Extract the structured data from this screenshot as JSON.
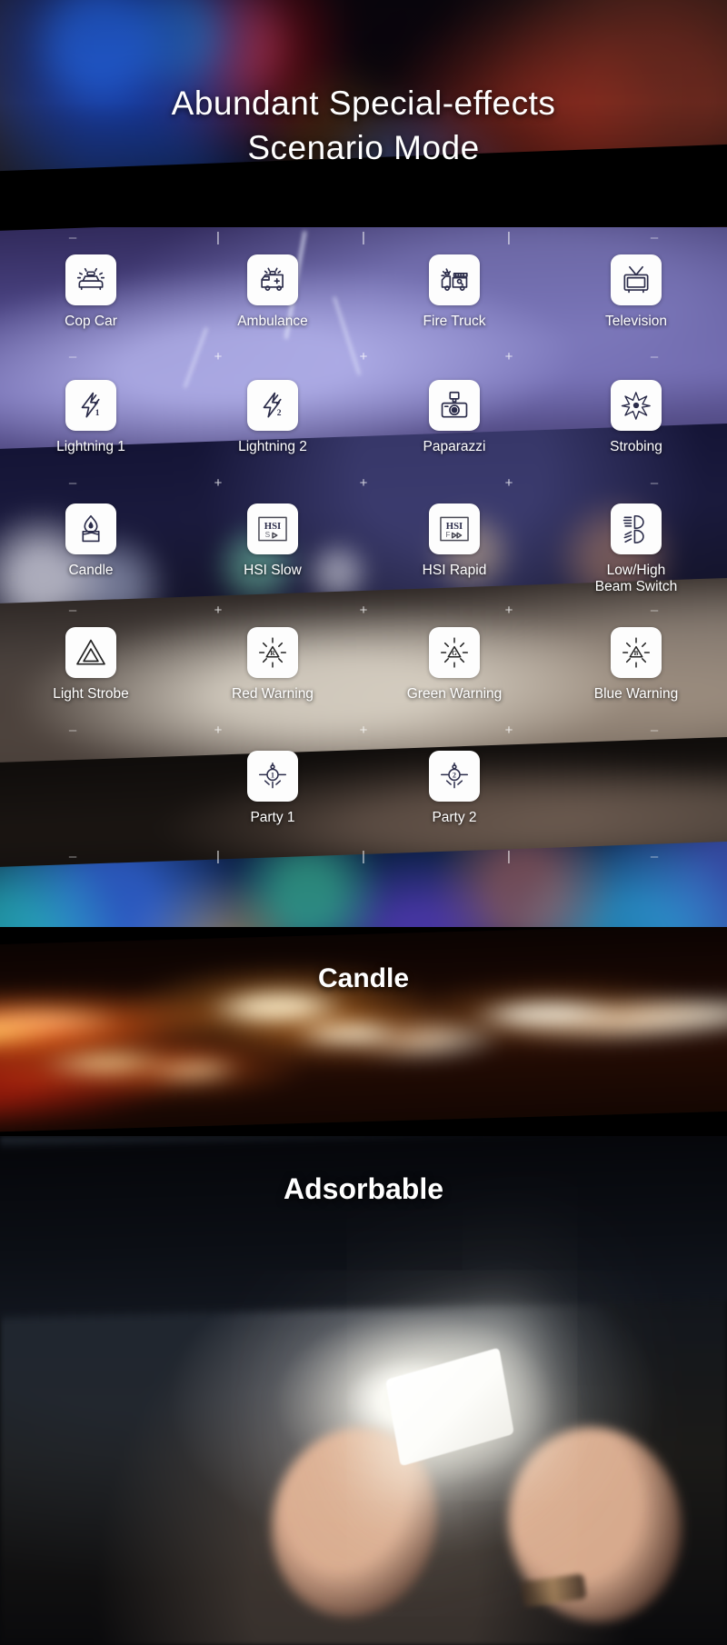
{
  "hero": {
    "title": "Abundant  Special-effects\nScenario  Mode"
  },
  "scenarios": {
    "tick_minus": "–",
    "tick_plus": "+",
    "tick_bar": "|",
    "rows": [
      {
        "cells": [
          {
            "label": "Cop Car",
            "icon": "cop-car-icon"
          },
          {
            "label": "Ambulance",
            "icon": "ambulance-icon"
          },
          {
            "label": "Fire Truck",
            "icon": "fire-truck-icon"
          },
          {
            "label": "Television",
            "icon": "television-icon"
          }
        ]
      },
      {
        "cells": [
          {
            "label": "Lightning 1",
            "icon": "lightning-1-icon"
          },
          {
            "label": "Lightning 2",
            "icon": "lightning-2-icon"
          },
          {
            "label": "Paparazzi",
            "icon": "camera-icon"
          },
          {
            "label": "Strobing",
            "icon": "strobe-burst-icon"
          }
        ]
      },
      {
        "cells": [
          {
            "label": "Candle",
            "icon": "candle-icon"
          },
          {
            "label": "HSI Slow",
            "icon": "hsi-slow-icon"
          },
          {
            "label": "HSI Rapid",
            "icon": "hsi-rapid-icon"
          },
          {
            "label": "Low/High\nBeam Switch",
            "icon": "headlight-beam-icon"
          }
        ]
      },
      {
        "cells": [
          {
            "label": "Light Strobe",
            "icon": "triangle-strobe-icon"
          },
          {
            "label": "Red Warning",
            "icon": "red-warning-icon"
          },
          {
            "label": "Green Warning",
            "icon": "green-warning-icon"
          },
          {
            "label": "Blue Warning",
            "icon": "blue-warning-icon"
          }
        ]
      },
      {
        "cells": [
          {
            "label": "Party 1",
            "icon": "party-1-icon"
          },
          {
            "label": "Party 2",
            "icon": "party-2-icon"
          }
        ]
      }
    ],
    "icon_glyphs": {
      "hsi_text": "HSI",
      "hsi_slow_sub": "S",
      "hsi_rapid_sub": "F",
      "lightning_1_num": "1",
      "lightning_2_num": "2",
      "party_1_num": "1",
      "party_2_num": "2",
      "red_warning_letter": "R",
      "green_warning_letter": "G",
      "blue_warning_letter": "B"
    }
  },
  "candle_section": {
    "title": "Candle"
  },
  "adsorbable_section": {
    "title": "Adsorbable"
  },
  "colors": {
    "icon_tile_bg": "#fdfdfd",
    "icon_stroke": "#2b2c4a",
    "label_text": "#ffffff",
    "page_bg": "#000000"
  }
}
